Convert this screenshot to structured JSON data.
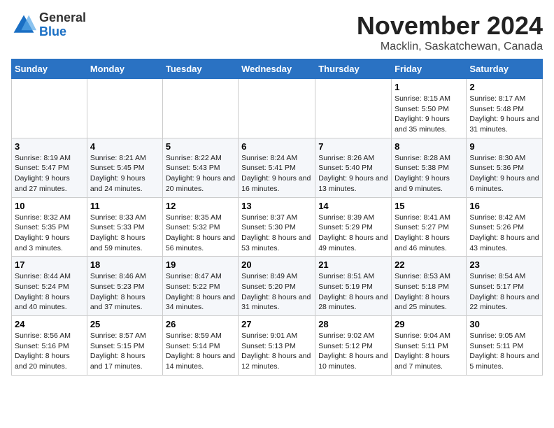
{
  "header": {
    "logo_general": "General",
    "logo_blue": "Blue",
    "month_title": "November 2024",
    "location": "Macklin, Saskatchewan, Canada"
  },
  "weekdays": [
    "Sunday",
    "Monday",
    "Tuesday",
    "Wednesday",
    "Thursday",
    "Friday",
    "Saturday"
  ],
  "weeks": [
    [
      {
        "day": "",
        "info": ""
      },
      {
        "day": "",
        "info": ""
      },
      {
        "day": "",
        "info": ""
      },
      {
        "day": "",
        "info": ""
      },
      {
        "day": "",
        "info": ""
      },
      {
        "day": "1",
        "info": "Sunrise: 8:15 AM\nSunset: 5:50 PM\nDaylight: 9 hours and 35 minutes."
      },
      {
        "day": "2",
        "info": "Sunrise: 8:17 AM\nSunset: 5:48 PM\nDaylight: 9 hours and 31 minutes."
      }
    ],
    [
      {
        "day": "3",
        "info": "Sunrise: 8:19 AM\nSunset: 5:47 PM\nDaylight: 9 hours and 27 minutes."
      },
      {
        "day": "4",
        "info": "Sunrise: 8:21 AM\nSunset: 5:45 PM\nDaylight: 9 hours and 24 minutes."
      },
      {
        "day": "5",
        "info": "Sunrise: 8:22 AM\nSunset: 5:43 PM\nDaylight: 9 hours and 20 minutes."
      },
      {
        "day": "6",
        "info": "Sunrise: 8:24 AM\nSunset: 5:41 PM\nDaylight: 9 hours and 16 minutes."
      },
      {
        "day": "7",
        "info": "Sunrise: 8:26 AM\nSunset: 5:40 PM\nDaylight: 9 hours and 13 minutes."
      },
      {
        "day": "8",
        "info": "Sunrise: 8:28 AM\nSunset: 5:38 PM\nDaylight: 9 hours and 9 minutes."
      },
      {
        "day": "9",
        "info": "Sunrise: 8:30 AM\nSunset: 5:36 PM\nDaylight: 9 hours and 6 minutes."
      }
    ],
    [
      {
        "day": "10",
        "info": "Sunrise: 8:32 AM\nSunset: 5:35 PM\nDaylight: 9 hours and 3 minutes."
      },
      {
        "day": "11",
        "info": "Sunrise: 8:33 AM\nSunset: 5:33 PM\nDaylight: 8 hours and 59 minutes."
      },
      {
        "day": "12",
        "info": "Sunrise: 8:35 AM\nSunset: 5:32 PM\nDaylight: 8 hours and 56 minutes."
      },
      {
        "day": "13",
        "info": "Sunrise: 8:37 AM\nSunset: 5:30 PM\nDaylight: 8 hours and 53 minutes."
      },
      {
        "day": "14",
        "info": "Sunrise: 8:39 AM\nSunset: 5:29 PM\nDaylight: 8 hours and 49 minutes."
      },
      {
        "day": "15",
        "info": "Sunrise: 8:41 AM\nSunset: 5:27 PM\nDaylight: 8 hours and 46 minutes."
      },
      {
        "day": "16",
        "info": "Sunrise: 8:42 AM\nSunset: 5:26 PM\nDaylight: 8 hours and 43 minutes."
      }
    ],
    [
      {
        "day": "17",
        "info": "Sunrise: 8:44 AM\nSunset: 5:24 PM\nDaylight: 8 hours and 40 minutes."
      },
      {
        "day": "18",
        "info": "Sunrise: 8:46 AM\nSunset: 5:23 PM\nDaylight: 8 hours and 37 minutes."
      },
      {
        "day": "19",
        "info": "Sunrise: 8:47 AM\nSunset: 5:22 PM\nDaylight: 8 hours and 34 minutes."
      },
      {
        "day": "20",
        "info": "Sunrise: 8:49 AM\nSunset: 5:20 PM\nDaylight: 8 hours and 31 minutes."
      },
      {
        "day": "21",
        "info": "Sunrise: 8:51 AM\nSunset: 5:19 PM\nDaylight: 8 hours and 28 minutes."
      },
      {
        "day": "22",
        "info": "Sunrise: 8:53 AM\nSunset: 5:18 PM\nDaylight: 8 hours and 25 minutes."
      },
      {
        "day": "23",
        "info": "Sunrise: 8:54 AM\nSunset: 5:17 PM\nDaylight: 8 hours and 22 minutes."
      }
    ],
    [
      {
        "day": "24",
        "info": "Sunrise: 8:56 AM\nSunset: 5:16 PM\nDaylight: 8 hours and 20 minutes."
      },
      {
        "day": "25",
        "info": "Sunrise: 8:57 AM\nSunset: 5:15 PM\nDaylight: 8 hours and 17 minutes."
      },
      {
        "day": "26",
        "info": "Sunrise: 8:59 AM\nSunset: 5:14 PM\nDaylight: 8 hours and 14 minutes."
      },
      {
        "day": "27",
        "info": "Sunrise: 9:01 AM\nSunset: 5:13 PM\nDaylight: 8 hours and 12 minutes."
      },
      {
        "day": "28",
        "info": "Sunrise: 9:02 AM\nSunset: 5:12 PM\nDaylight: 8 hours and 10 minutes."
      },
      {
        "day": "29",
        "info": "Sunrise: 9:04 AM\nSunset: 5:11 PM\nDaylight: 8 hours and 7 minutes."
      },
      {
        "day": "30",
        "info": "Sunrise: 9:05 AM\nSunset: 5:11 PM\nDaylight: 8 hours and 5 minutes."
      }
    ]
  ]
}
